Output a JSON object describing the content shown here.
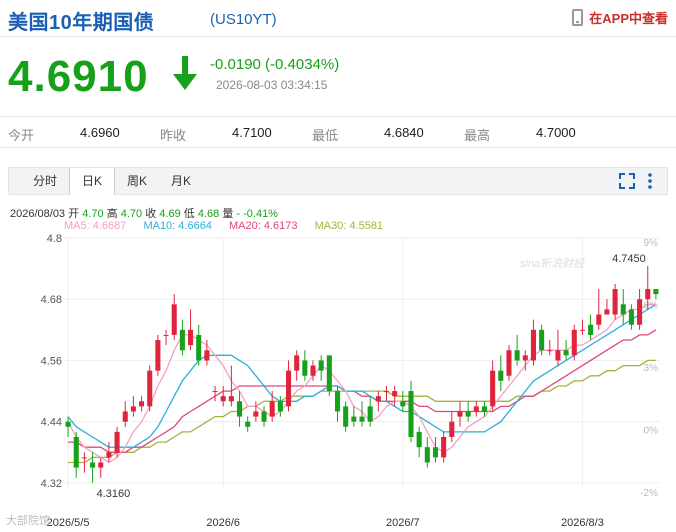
{
  "header": {
    "title": "美国10年期国债",
    "symbol": "(US10YT)",
    "app_link": "在APP中查看"
  },
  "quote": {
    "price": "4.6910",
    "change": "-0.0190 (-0.4034%)",
    "timestamp": "2026-08-03 03:34:15"
  },
  "stats": [
    {
      "label": "今开",
      "value": "4.6960"
    },
    {
      "label": "昨收",
      "value": "4.7100"
    },
    {
      "label": "最低",
      "value": "4.6840"
    },
    {
      "label": "最高",
      "value": "4.7000"
    }
  ],
  "tabs": [
    "分时",
    "日K",
    "周K",
    "月K"
  ],
  "active_tab": "日K",
  "ohlc": {
    "date": "2026/08/03",
    "open_label": "开",
    "open": "4.70",
    "high_label": "高",
    "high": "4.70",
    "close_label": "收",
    "close": "4.69",
    "low_label": "低",
    "low": "4.68",
    "vol_label": "量",
    "vol": "-",
    "pct": "-0.41%"
  },
  "ma": [
    {
      "label": "MA5: 4.6687",
      "color": "#f4a0c0"
    },
    {
      "label": "MA10: 4.6664",
      "color": "#2ab0d8"
    },
    {
      "label": "MA20: 4.6173",
      "color": "#e0477a"
    },
    {
      "label": "MA30: 4.5581",
      "color": "#a6b33a"
    }
  ],
  "watermark": "大部院馆",
  "sina_mark": "sina新浪财经",
  "chart_data": {
    "type": "candlestick",
    "y_ticks": [
      "4.8",
      "4.68",
      "4.56",
      "4.44",
      "4.32"
    ],
    "y_tick_values": [
      4.8,
      4.68,
      4.56,
      4.44,
      4.32
    ],
    "pct_ticks": [
      "9%",
      "6%",
      "3%",
      "0%",
      "-2%"
    ],
    "x_labels": [
      "2026/5/5",
      "2026/6",
      "2026/7",
      "2026/8/3"
    ],
    "x_label_index": [
      0,
      19,
      41,
      63
    ],
    "ylim": [
      4.31,
      4.8
    ],
    "max_label": "4.7450",
    "min_label": "4.3160",
    "up_color": "#e0243c",
    "down_color": "#17a11a",
    "candles": [
      [
        4.44,
        4.43,
        4.45,
        4.41
      ],
      [
        4.41,
        4.35,
        4.42,
        4.33
      ],
      [
        4.37,
        4.37,
        4.38,
        4.34
      ],
      [
        4.36,
        4.35,
        4.38,
        4.32
      ],
      [
        4.35,
        4.36,
        4.37,
        4.33
      ],
      [
        4.37,
        4.38,
        4.4,
        4.36
      ],
      [
        4.38,
        4.42,
        4.43,
        4.37
      ],
      [
        4.44,
        4.46,
        4.48,
        4.43
      ],
      [
        4.46,
        4.47,
        4.49,
        4.45
      ],
      [
        4.47,
        4.48,
        4.49,
        4.46
      ],
      [
        4.47,
        4.54,
        4.55,
        4.46
      ],
      [
        4.54,
        4.6,
        4.61,
        4.53
      ],
      [
        4.61,
        4.61,
        4.62,
        4.59
      ],
      [
        4.61,
        4.67,
        4.69,
        4.6
      ],
      [
        4.62,
        4.58,
        4.64,
        4.57
      ],
      [
        4.59,
        4.62,
        4.66,
        4.58
      ],
      [
        4.61,
        4.56,
        4.63,
        4.55
      ],
      [
        4.56,
        4.58,
        4.6,
        4.55
      ],
      [
        4.5,
        4.5,
        4.51,
        4.48
      ],
      [
        4.48,
        4.49,
        4.51,
        4.47
      ],
      [
        4.48,
        4.49,
        4.55,
        4.47
      ],
      [
        4.48,
        4.45,
        4.5,
        4.43
      ],
      [
        4.44,
        4.43,
        4.45,
        4.42
      ],
      [
        4.45,
        4.46,
        4.48,
        4.44
      ],
      [
        4.46,
        4.44,
        4.47,
        4.43
      ],
      [
        4.45,
        4.48,
        4.5,
        4.44
      ],
      [
        4.48,
        4.46,
        4.49,
        4.45
      ],
      [
        4.47,
        4.54,
        4.56,
        4.46
      ],
      [
        4.54,
        4.57,
        4.58,
        4.52
      ],
      [
        4.56,
        4.53,
        4.58,
        4.52
      ],
      [
        4.53,
        4.55,
        4.56,
        4.52
      ],
      [
        4.56,
        4.54,
        4.57,
        4.52
      ],
      [
        4.57,
        4.5,
        4.57,
        4.49
      ],
      [
        4.5,
        4.46,
        4.51,
        4.44
      ],
      [
        4.47,
        4.43,
        4.48,
        4.42
      ],
      [
        4.45,
        4.44,
        4.47,
        4.43
      ],
      [
        4.45,
        4.44,
        4.48,
        4.43
      ],
      [
        4.47,
        4.44,
        4.49,
        4.43
      ],
      [
        4.48,
        4.49,
        4.5,
        4.46
      ],
      [
        4.5,
        4.5,
        4.51,
        4.48
      ],
      [
        4.49,
        4.5,
        4.51,
        4.47
      ],
      [
        4.48,
        4.47,
        4.5,
        4.46
      ],
      [
        4.5,
        4.41,
        4.52,
        4.4
      ],
      [
        4.42,
        4.39,
        4.43,
        4.37
      ],
      [
        4.39,
        4.36,
        4.41,
        4.35
      ],
      [
        4.39,
        4.37,
        4.41,
        4.36
      ],
      [
        4.37,
        4.41,
        4.42,
        4.36
      ],
      [
        4.41,
        4.44,
        4.46,
        4.4
      ],
      [
        4.45,
        4.46,
        4.48,
        4.43
      ],
      [
        4.46,
        4.45,
        4.48,
        4.44
      ],
      [
        4.46,
        4.47,
        4.48,
        4.45
      ],
      [
        4.47,
        4.46,
        4.48,
        4.45
      ],
      [
        4.47,
        4.54,
        4.56,
        4.46
      ],
      [
        4.54,
        4.52,
        4.57,
        4.5
      ],
      [
        4.53,
        4.58,
        4.59,
        4.52
      ],
      [
        4.58,
        4.56,
        4.61,
        4.55
      ],
      [
        4.56,
        4.57,
        4.58,
        4.54
      ],
      [
        4.56,
        4.62,
        4.64,
        4.55
      ],
      [
        4.62,
        4.58,
        4.63,
        4.57
      ],
      [
        4.58,
        4.58,
        4.6,
        4.57
      ],
      [
        4.56,
        4.58,
        4.62,
        4.55
      ],
      [
        4.58,
        4.57,
        4.6,
        4.56
      ],
      [
        4.57,
        4.62,
        4.63,
        4.56
      ],
      [
        4.62,
        4.62,
        4.64,
        4.61
      ],
      [
        4.63,
        4.61,
        4.65,
        4.6
      ],
      [
        4.63,
        4.65,
        4.7,
        4.62
      ],
      [
        4.65,
        4.66,
        4.68,
        4.65
      ],
      [
        4.65,
        4.7,
        4.71,
        4.64
      ],
      [
        4.67,
        4.65,
        4.7,
        4.63
      ],
      [
        4.66,
        4.63,
        4.67,
        4.62
      ],
      [
        4.63,
        4.68,
        4.7,
        4.62
      ],
      [
        4.68,
        4.7,
        4.745,
        4.66
      ],
      [
        4.7,
        4.69,
        4.7,
        4.68
      ]
    ],
    "ma5": [
      4.44,
      4.41,
      4.39,
      4.38,
      4.37,
      4.36,
      4.37,
      4.39,
      4.42,
      4.44,
      4.47,
      4.51,
      4.54,
      4.58,
      4.61,
      4.61,
      4.6,
      4.59,
      4.57,
      4.55,
      4.52,
      4.5,
      4.47,
      4.47,
      4.46,
      4.45,
      4.46,
      4.48,
      4.5,
      4.51,
      4.53,
      4.55,
      4.54,
      4.52,
      4.5,
      4.47,
      4.46,
      4.44,
      4.45,
      4.47,
      4.48,
      4.48,
      4.47,
      4.45,
      4.42,
      4.39,
      4.38,
      4.39,
      4.41,
      4.43,
      4.44,
      4.45,
      4.47,
      4.49,
      4.51,
      4.53,
      4.55,
      4.57,
      4.58,
      4.58,
      4.58,
      4.58,
      4.59,
      4.59,
      4.6,
      4.61,
      4.62,
      4.64,
      4.65,
      4.66,
      4.66,
      4.67,
      4.67
    ],
    "ma10": [
      4.45,
      4.43,
      4.42,
      4.41,
      4.4,
      4.39,
      4.39,
      4.39,
      4.39,
      4.4,
      4.41,
      4.43,
      4.46,
      4.49,
      4.52,
      4.54,
      4.56,
      4.57,
      4.57,
      4.57,
      4.57,
      4.56,
      4.55,
      4.53,
      4.51,
      4.49,
      4.48,
      4.48,
      4.48,
      4.49,
      4.49,
      4.5,
      4.51,
      4.51,
      4.5,
      4.5,
      4.5,
      4.49,
      4.48,
      4.48,
      4.47,
      4.46,
      4.46,
      4.45,
      4.44,
      4.43,
      4.42,
      4.42,
      4.42,
      4.42,
      4.42,
      4.42,
      4.43,
      4.44,
      4.46,
      4.48,
      4.5,
      4.52,
      4.53,
      4.54,
      4.55,
      4.56,
      4.57,
      4.58,
      4.59,
      4.6,
      4.61,
      4.62,
      4.63,
      4.64,
      4.65,
      4.66,
      4.67
    ],
    "ma20": [
      4.4,
      4.4,
      4.39,
      4.39,
      4.39,
      4.38,
      4.38,
      4.38,
      4.39,
      4.39,
      4.4,
      4.41,
      4.42,
      4.43,
      4.45,
      4.46,
      4.47,
      4.48,
      4.49,
      4.5,
      4.5,
      4.51,
      4.51,
      4.51,
      4.51,
      4.51,
      4.51,
      4.51,
      4.51,
      4.51,
      4.51,
      4.51,
      4.51,
      4.51,
      4.5,
      4.5,
      4.49,
      4.49,
      4.48,
      4.48,
      4.48,
      4.48,
      4.48,
      4.47,
      4.47,
      4.46,
      4.46,
      4.46,
      4.46,
      4.46,
      4.46,
      4.46,
      4.46,
      4.47,
      4.47,
      4.48,
      4.49,
      4.49,
      4.5,
      4.51,
      4.52,
      4.53,
      4.54,
      4.55,
      4.56,
      4.57,
      4.58,
      4.59,
      4.6,
      4.6,
      4.61,
      4.61,
      4.62
    ],
    "ma30": [
      4.36,
      4.36,
      4.36,
      4.37,
      4.37,
      4.37,
      4.38,
      4.38,
      4.38,
      4.39,
      4.39,
      4.4,
      4.4,
      4.41,
      4.42,
      4.42,
      4.43,
      4.44,
      4.45,
      4.45,
      4.46,
      4.46,
      4.47,
      4.47,
      4.48,
      4.48,
      4.48,
      4.49,
      4.49,
      4.49,
      4.49,
      4.5,
      4.5,
      4.5,
      4.5,
      4.5,
      4.5,
      4.5,
      4.5,
      4.5,
      4.49,
      4.49,
      4.49,
      4.49,
      4.49,
      4.48,
      4.48,
      4.48,
      4.48,
      4.48,
      4.48,
      4.48,
      4.48,
      4.48,
      4.48,
      4.49,
      4.49,
      4.49,
      4.5,
      4.5,
      4.51,
      4.51,
      4.52,
      4.52,
      4.53,
      4.53,
      4.54,
      4.54,
      4.55,
      4.55,
      4.55,
      4.56,
      4.56
    ]
  }
}
